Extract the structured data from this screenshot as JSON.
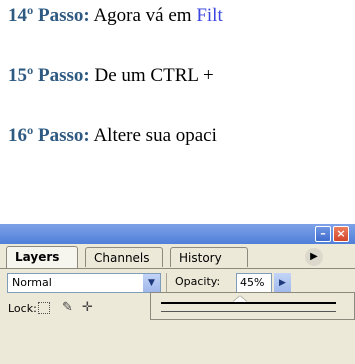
{
  "steps": [
    {
      "number": "14º Passo:",
      "text": " Agora vá em ",
      "link": "Filt"
    },
    {
      "number": "15º Passo:",
      "text": " De um CTRL + "
    },
    {
      "number": "16º Passo:",
      "text": " Altere sua opaci"
    }
  ],
  "palette": {
    "tabs": [
      "Layers",
      "Channels",
      "History"
    ],
    "more_icon": "triangle-right-icon",
    "blend_mode": "Normal",
    "opacity_label": "Opacity:",
    "opacity_value": "45%",
    "opacity_level": 0.45,
    "lock_label": "Lock:",
    "lock_icons": [
      "lock-transparent-icon",
      "lock-brush-icon",
      "lock-move-icon"
    ]
  },
  "colors": {
    "step_number": "#2e5a82",
    "link": "#3b46e0",
    "titlebar": "#4f7fd9",
    "close_button": "#d2462a"
  }
}
